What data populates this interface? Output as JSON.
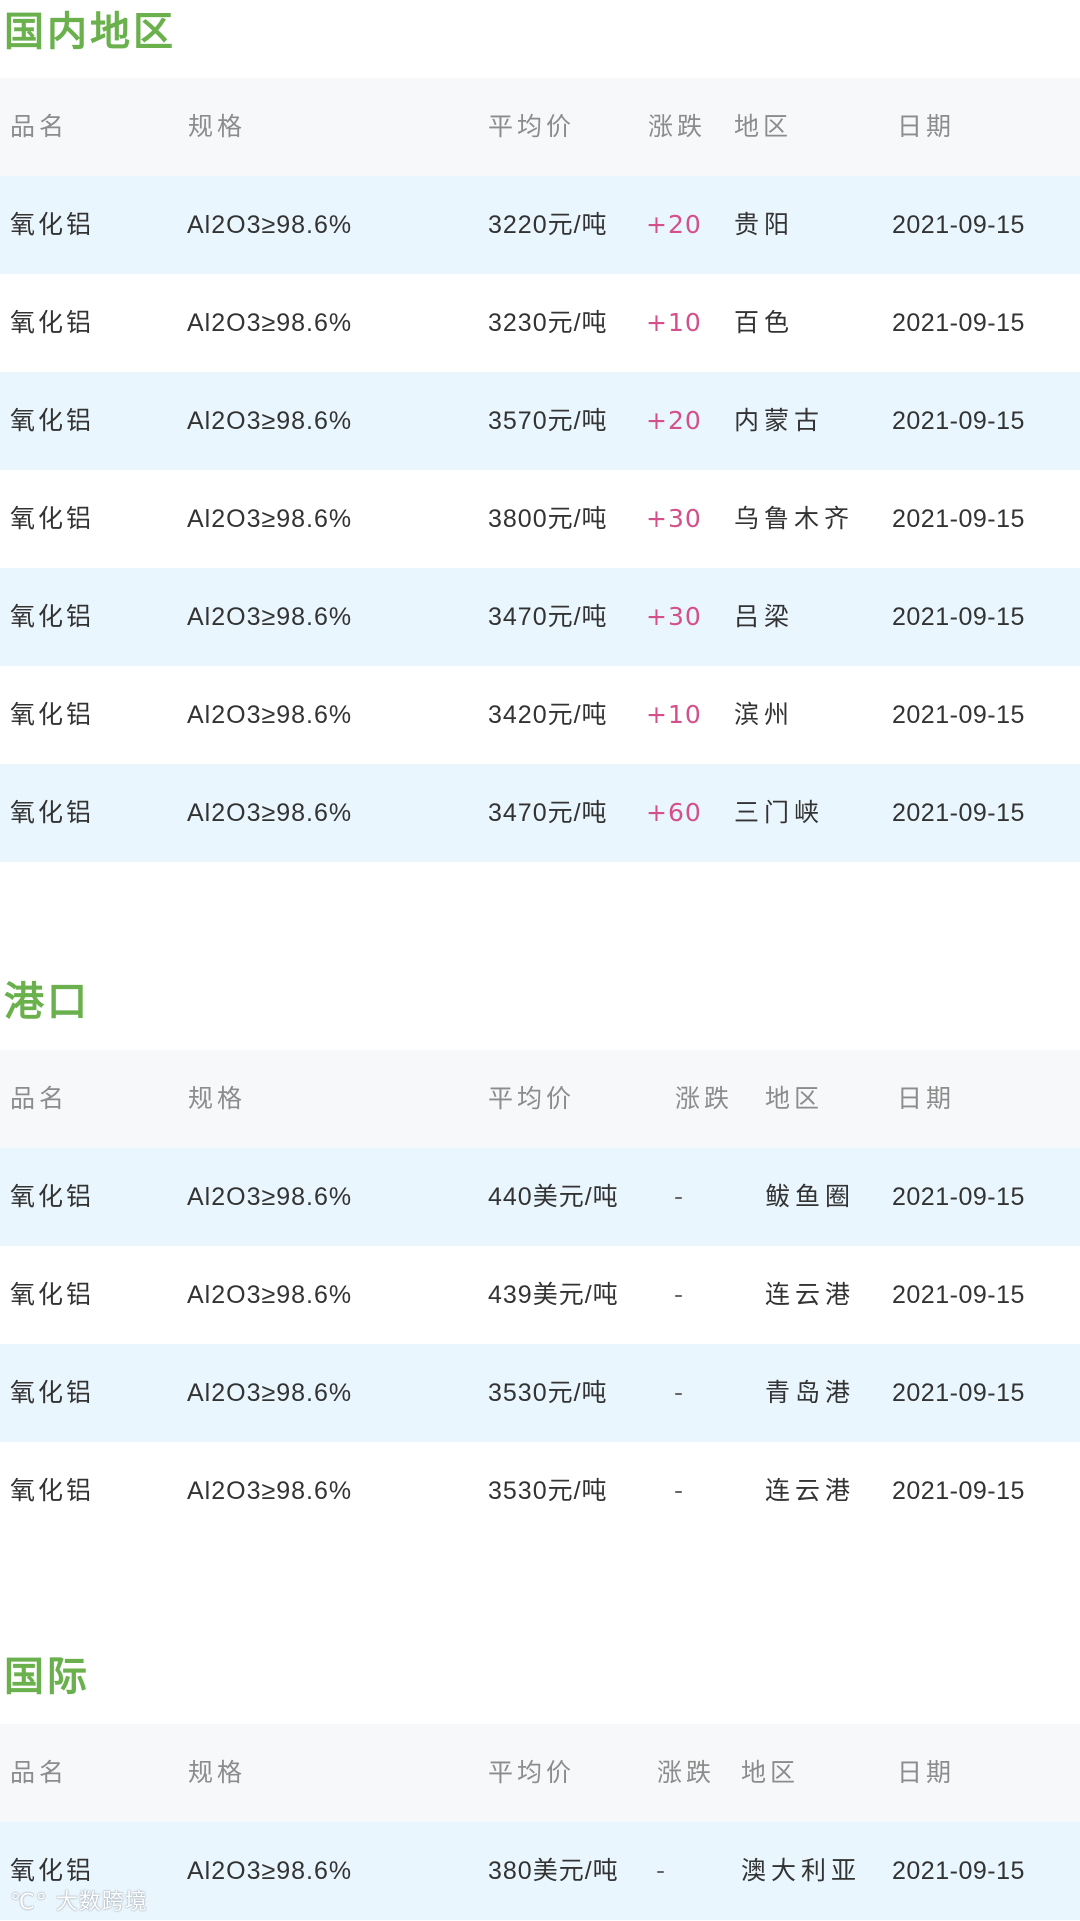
{
  "watermark": "大数跨境",
  "sections": [
    {
      "title": "国内地区",
      "headers": [
        "品名",
        "规格",
        "平均价",
        "涨跌",
        "地区",
        "日期"
      ],
      "rows": [
        {
          "name": "氧化铝",
          "spec": "Al2O3≥98.6%",
          "price": "3220元/吨",
          "change": "+20",
          "region": "贵阳",
          "date": "2021-09-15"
        },
        {
          "name": "氧化铝",
          "spec": "Al2O3≥98.6%",
          "price": "3230元/吨",
          "change": "+10",
          "region": "百色",
          "date": "2021-09-15"
        },
        {
          "name": "氧化铝",
          "spec": "Al2O3≥98.6%",
          "price": "3570元/吨",
          "change": "+20",
          "region": "内蒙古",
          "date": "2021-09-15"
        },
        {
          "name": "氧化铝",
          "spec": "Al2O3≥98.6%",
          "price": "3800元/吨",
          "change": "+30",
          "region": "乌鲁木齐",
          "date": "2021-09-15"
        },
        {
          "name": "氧化铝",
          "spec": "Al2O3≥98.6%",
          "price": "3470元/吨",
          "change": "+30",
          "region": "吕梁",
          "date": "2021-09-15"
        },
        {
          "name": "氧化铝",
          "spec": "Al2O3≥98.6%",
          "price": "3420元/吨",
          "change": "+10",
          "region": "滨州",
          "date": "2021-09-15"
        },
        {
          "name": "氧化铝",
          "spec": "Al2O3≥98.6%",
          "price": "3470元/吨",
          "change": "+60",
          "region": "三门峡",
          "date": "2021-09-15"
        }
      ]
    },
    {
      "title": "港口",
      "headers": [
        "品名",
        "规格",
        "平均价",
        "涨跌",
        "地区",
        "日期"
      ],
      "rows": [
        {
          "name": "氧化铝",
          "spec": "Al2O3≥98.6%",
          "price": "440美元/吨",
          "change": "-",
          "region": "鲅鱼圈",
          "date": "2021-09-15"
        },
        {
          "name": "氧化铝",
          "spec": "Al2O3≥98.6%",
          "price": "439美元/吨",
          "change": "-",
          "region": "连云港",
          "date": "2021-09-15"
        },
        {
          "name": "氧化铝",
          "spec": "Al2O3≥98.6%",
          "price": "3530元/吨",
          "change": "-",
          "region": "青岛港",
          "date": "2021-09-15"
        },
        {
          "name": "氧化铝",
          "spec": "Al2O3≥98.6%",
          "price": "3530元/吨",
          "change": "-",
          "region": "连云港",
          "date": "2021-09-15"
        }
      ]
    },
    {
      "title": "国际",
      "headers": [
        "品名",
        "规格",
        "平均价",
        "涨跌",
        "地区",
        "日期"
      ],
      "rows": [
        {
          "name": "氧化铝",
          "spec": "Al2O3≥98.6%",
          "price": "380美元/吨",
          "change": "-",
          "region": "澳大利亚",
          "date": "2021-09-15"
        }
      ]
    }
  ]
}
